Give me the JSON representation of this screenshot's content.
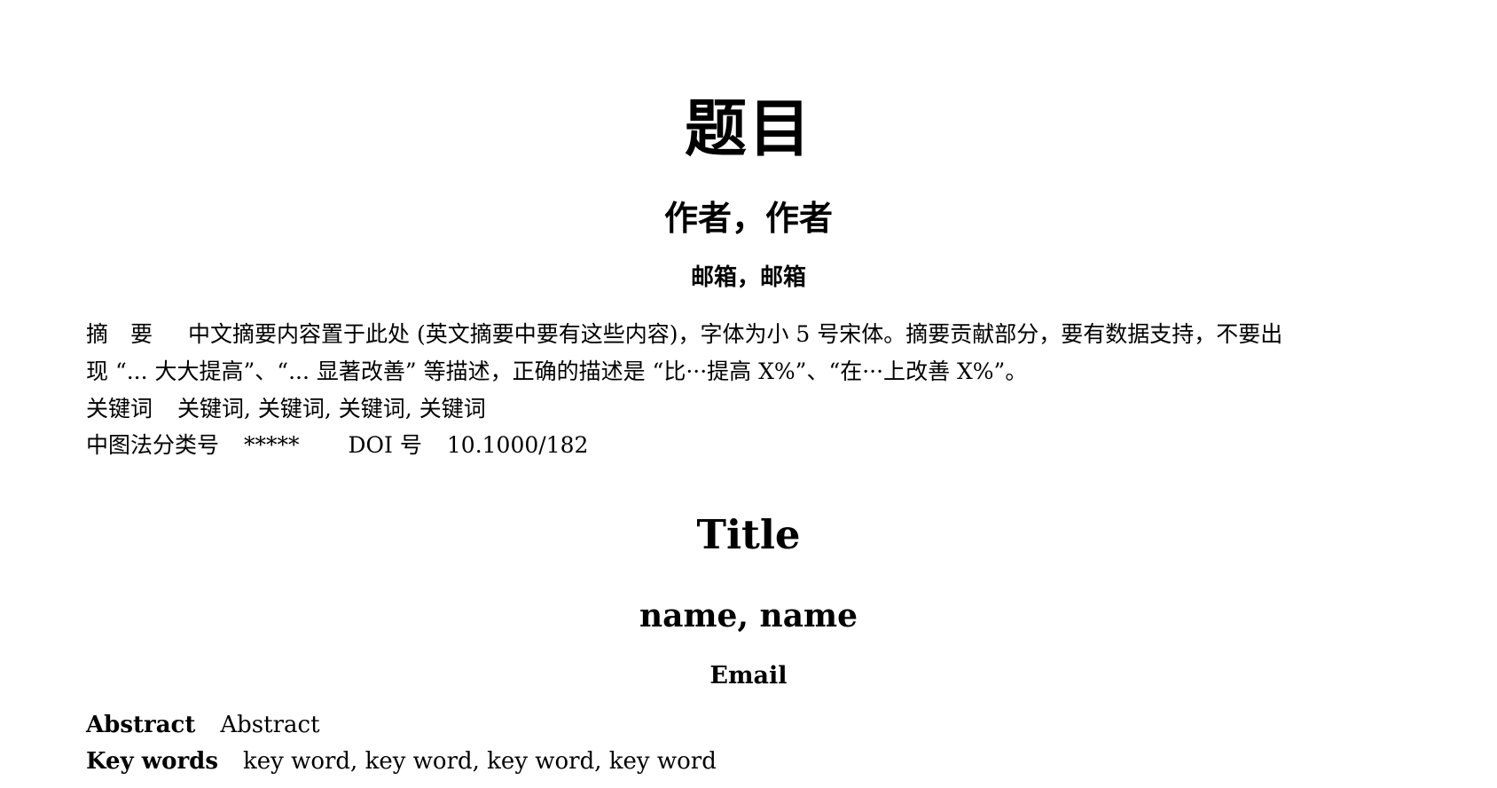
{
  "chinese": {
    "title": "题目",
    "authors": "作者，作者",
    "emails": "邮箱，邮箱",
    "abstract_label": "摘　要",
    "abstract_line1": "中文摘要内容置于此处 (英文摘要中要有这些内容)，字体为小 5 号宋体。摘要贡献部分，要有数据支持，不要出",
    "abstract_line2": "现 “... 大大提高”、“... 显著改善” 等描述，正确的描述是 “比···提高 X%”、“在···上改善 X%”。",
    "keywords_label": "关键词",
    "keywords": "关键词, 关键词, 关键词, 关键词",
    "classification_label": "中图法分类号",
    "classification_value": "*****",
    "doi_label": "DOI 号",
    "doi_value": "10.1000/182"
  },
  "english": {
    "title": "Title",
    "authors": "name, name",
    "email": "Email",
    "abstract_label": "Abstract",
    "abstract_text": "Abstract",
    "keywords_label": "Key words",
    "keywords": "key word, key word, key word, key word"
  }
}
